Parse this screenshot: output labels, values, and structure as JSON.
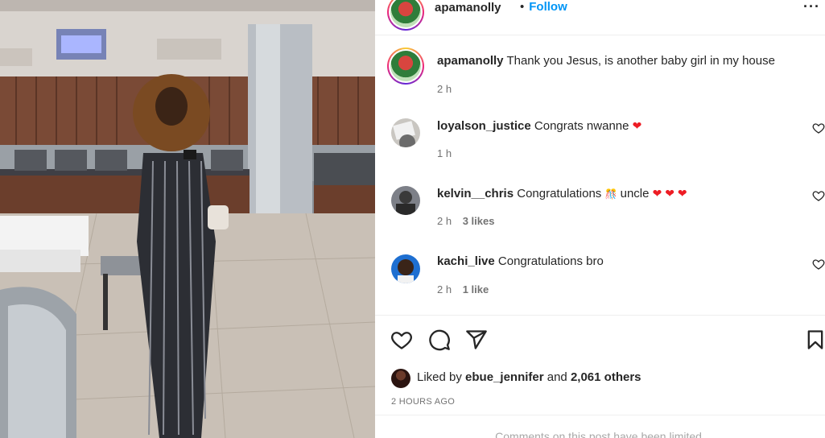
{
  "header": {
    "username": "apamanolly",
    "separator": "•",
    "follow_label": "Follow",
    "more_label": "···"
  },
  "caption": {
    "username": "apamanolly",
    "text": "Thank you Jesus, is another baby girl in my house",
    "time": "2 h"
  },
  "comments": [
    {
      "username": "loyalson_justice",
      "text": "Congrats nwanne",
      "emoji": "❤",
      "time": "1 h",
      "likes": ""
    },
    {
      "username": "kelvin__chris",
      "text": "Congratulations",
      "emoji_mid": "🎊",
      "text2": "uncle",
      "emoji": "❤ ❤ ❤",
      "time": "2 h",
      "likes": "3 likes"
    },
    {
      "username": "kachi_live",
      "text": "Congratulations bro",
      "emoji": "",
      "time": "2 h",
      "likes": "1 like"
    }
  ],
  "likes": {
    "prefix": "Liked by",
    "user": "ebue_jennifer",
    "and": "and",
    "others": "2,061 others"
  },
  "posted_ago": "2 HOURS AGO",
  "comments_limited": "Comments on this post have been limited.",
  "colors": {
    "accent": "#0095f6",
    "heart": "#ed1c24",
    "meta": "#737373"
  },
  "icons": [
    "heart-icon",
    "comment-icon",
    "share-icon",
    "bookmark-icon",
    "more-icon"
  ]
}
